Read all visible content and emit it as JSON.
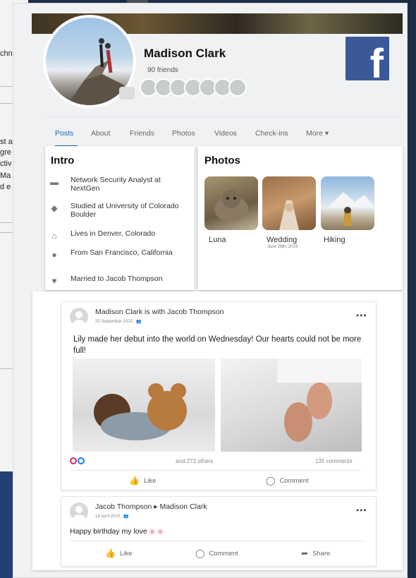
{
  "background": {
    "doc_fragments": [
      "chn",
      "st a",
      "gre",
      "ctiv",
      "Ma",
      "d e"
    ]
  },
  "profile": {
    "name": "Madison Clark",
    "friends_count": "90 friends",
    "brand_logo": "f"
  },
  "tabs": [
    {
      "label": "Posts",
      "active": true
    },
    {
      "label": "About"
    },
    {
      "label": "Friends"
    },
    {
      "label": "Photos"
    },
    {
      "label": "Videos"
    },
    {
      "label": "Check-ins"
    },
    {
      "label": "More ▾"
    }
  ],
  "intro": {
    "title": "Intro",
    "items": [
      {
        "icon": "briefcase-icon",
        "text": "Network Security Analyst at NextGen"
      },
      {
        "icon": "graduation-cap-icon",
        "text": "Studied at University of Colorado Boulder"
      },
      {
        "icon": "home-icon",
        "text": "Lives in Denver, Colorado"
      },
      {
        "icon": "location-pin-icon",
        "text": "From San Francisco, California"
      },
      {
        "icon": "heart-icon",
        "text": "Married to Jacob Thompson"
      }
    ]
  },
  "photos": {
    "title": "Photos",
    "items": [
      {
        "caption": "Luna",
        "sub": ""
      },
      {
        "caption": "Wedding",
        "sub": "June 29th, 2019"
      },
      {
        "caption": "Hiking",
        "sub": ""
      }
    ]
  },
  "post1": {
    "author": "Madison Clark is with Jacob Thompson",
    "date": "20 September 2023 · 👥",
    "more": "•••",
    "text": "Lily made her debut into the world on Wednesday! Our hearts could not be more full!",
    "reactions_text": "and 273 others",
    "comments_count": "135 comments",
    "like": "Like",
    "comment": "Comment"
  },
  "post2": {
    "author": "Jacob Thompson ▸ Madison Clark",
    "date": "14 April 2023 · 👥",
    "more": "•••",
    "text": "Happy birthday my love",
    "like": "Like",
    "comment": "Comment",
    "share": "Share"
  },
  "colors": {
    "accent": "#1e63b8",
    "facebook": "#3b5998"
  }
}
